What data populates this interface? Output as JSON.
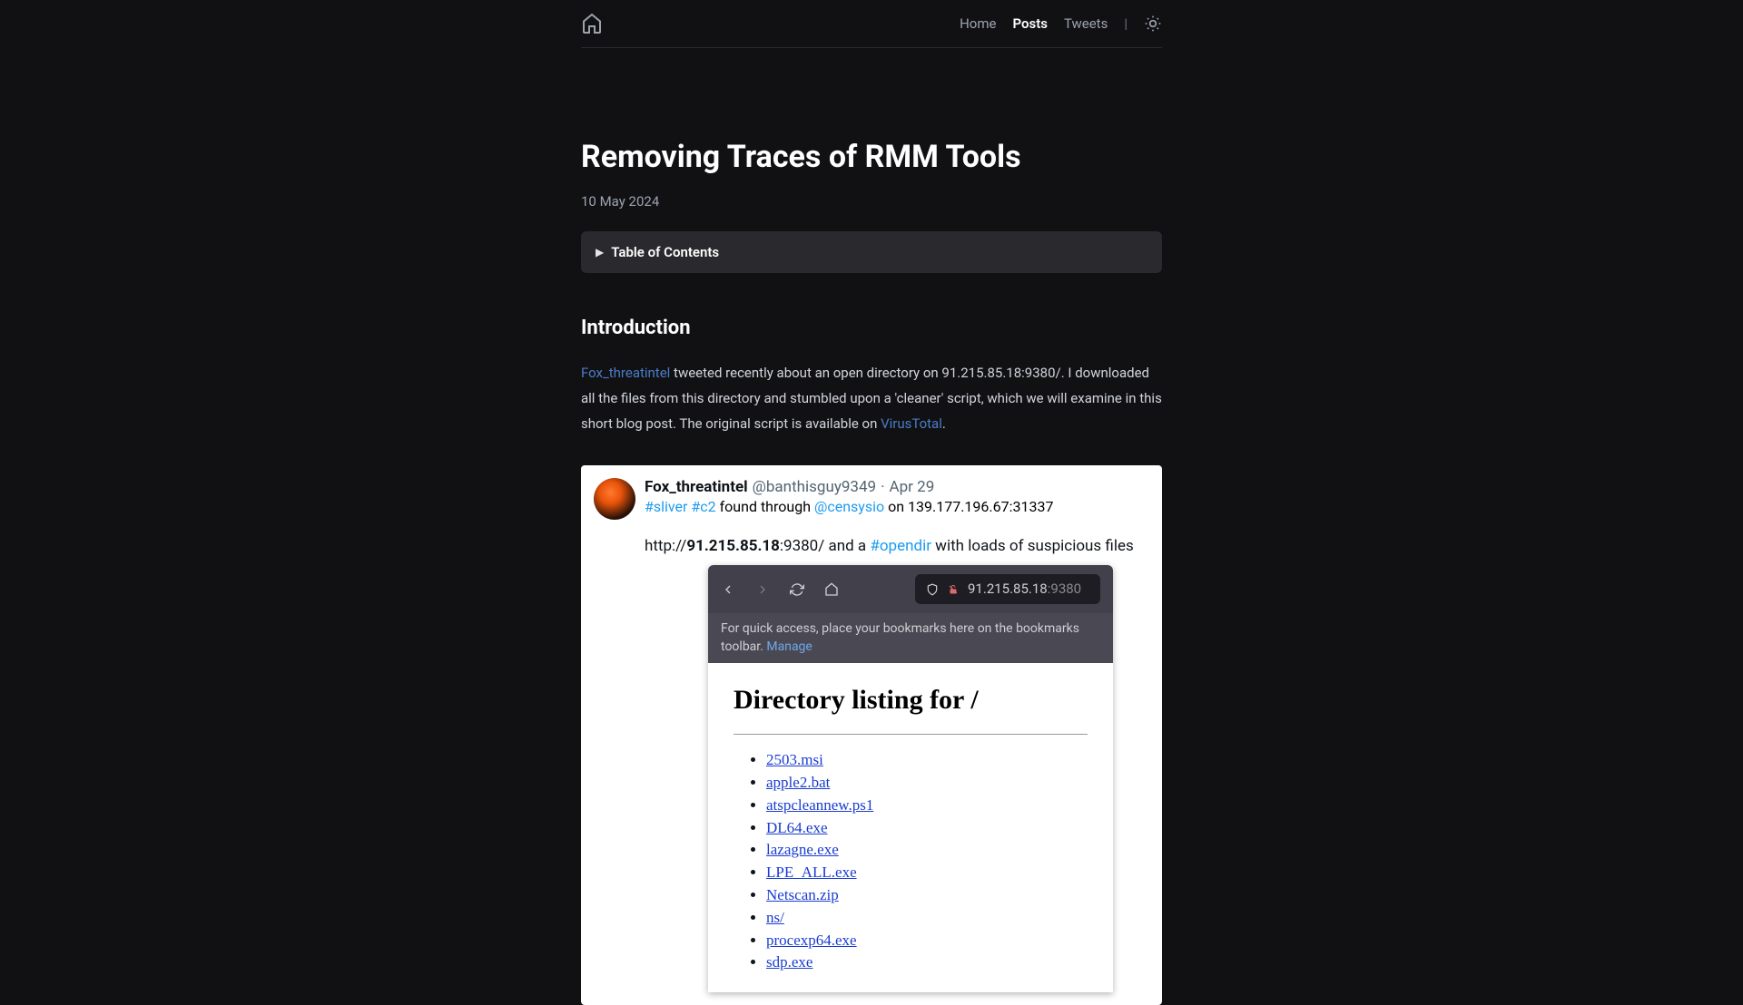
{
  "nav": {
    "home": "Home",
    "posts": "Posts",
    "tweets": "Tweets",
    "divider": "|"
  },
  "article": {
    "title": "Removing Traces of RMM Tools",
    "date": "10 May 2024",
    "toc_label": "Table of Contents",
    "section1_heading": "Introduction",
    "intro_link1": "Fox_threatintel",
    "intro_text1": " tweeted recently about an open directory on 91.215.85.18:9380/. I downloaded all the files from this directory and stumbled upon a 'cleaner' script, which we will examine in this short blog post. The original script is available on ",
    "intro_link2": "VirusTotal",
    "intro_text2": "."
  },
  "tweet": {
    "author": "Fox_threatintel",
    "handle": "@banthisguy9349",
    "sep": " · ",
    "date": "Apr 29",
    "hashtag1": "#sliver",
    "hashtag2": "#c2",
    "text1": " found through ",
    "mention1": "@censysio",
    "text2": "  on 139.177.196.67:31337",
    "text3": "http://",
    "ip": "91.215.85.18",
    "text4": ":9380/ and a ",
    "hashtag3": "#opendir",
    "text5": " with loads of suspicious files"
  },
  "browser": {
    "address_ip": "91.215.85.18",
    "address_port": ":9380",
    "bookmark_text": "For quick access, place your bookmarks here on the bookmarks toolbar. ",
    "manage": "Manage"
  },
  "directory": {
    "title": "Directory listing for /",
    "files": [
      "2503.msi",
      "apple2.bat",
      "atspcleannew.ps1",
      "DL64.exe",
      "lazagne.exe",
      "LPE_ALL.exe",
      "Netscan.zip",
      "ns/",
      "procexp64.exe",
      "sdp.exe"
    ]
  }
}
